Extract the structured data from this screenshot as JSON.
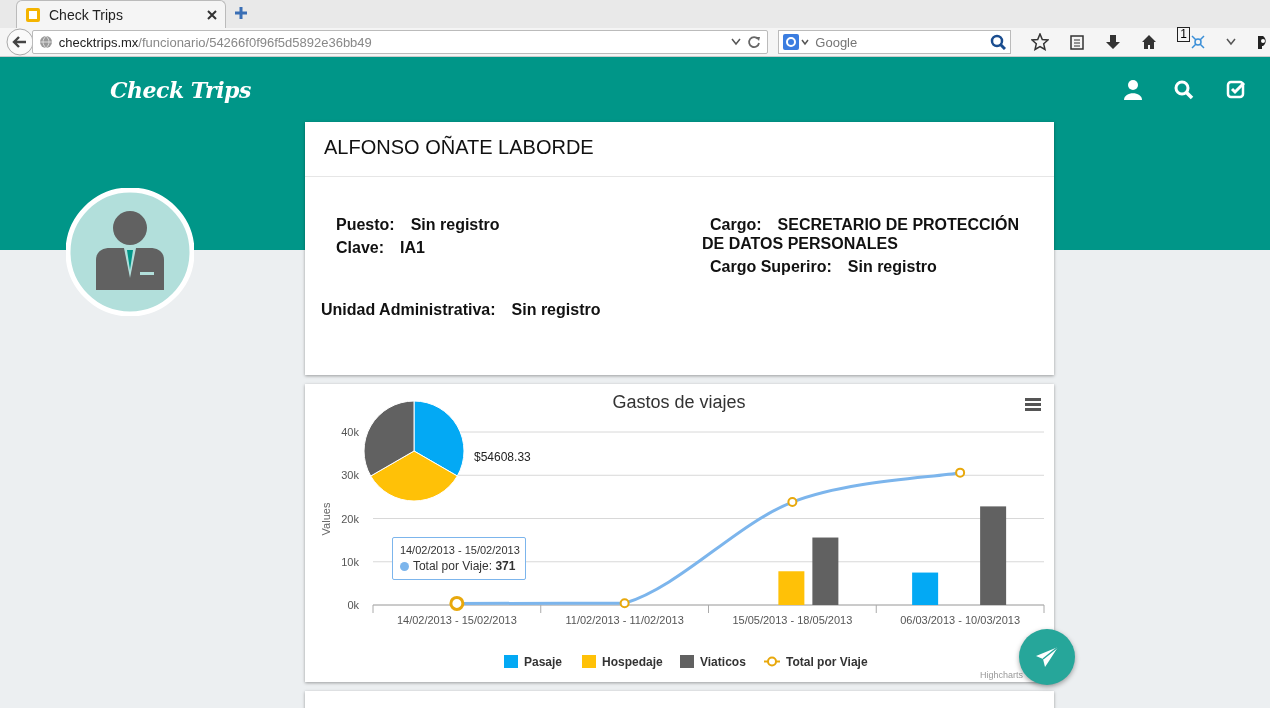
{
  "browser": {
    "tabs": [
      {
        "title": "Check Trips",
        "selected": true
      }
    ],
    "url": {
      "host": "checktrips.mx",
      "path": "/funcionario/54266f0f96f5d5892e36bb49"
    },
    "search": {
      "placeholder": "Google"
    },
    "badge": "1"
  },
  "app": {
    "logo": "Check Trips"
  },
  "profile": {
    "name": "ALFONSO OÑATE LABORDE",
    "fields_left": [
      {
        "label": "Puesto:",
        "value": "Sin registro"
      },
      {
        "label": "Clave:",
        "value": "IA1"
      }
    ],
    "fields_right": [
      {
        "label": "Cargo:",
        "value": "SECRETARIO DE PROTECCIÓN DE DATOS PERSONALES"
      },
      {
        "label": "Cargo Superiro:",
        "value": "Sin registro"
      }
    ],
    "unit": {
      "label": "Unidad Administrativa:",
      "value": "Sin registro"
    }
  },
  "expenses": {
    "chart_data": {
      "type": "bar",
      "title": "Gastos de viajes",
      "ylabel": "Values",
      "categories": [
        "14/02/2013 - 15/02/2013",
        "11/02/2013 - 11/02/2013",
        "15/05/2013 - 18/05/2013",
        "06/03/2013 - 10/03/2013"
      ],
      "ylim": [
        0,
        40000
      ],
      "yticks": [
        {
          "value": 0,
          "label": "0k"
        },
        {
          "value": 10000,
          "label": "10k"
        },
        {
          "value": 20000,
          "label": "20k"
        },
        {
          "value": 30000,
          "label": "30k"
        },
        {
          "value": 40000,
          "label": "40k"
        }
      ],
      "series": [
        {
          "name": "Pasaje",
          "color": "#03a9f4",
          "type": "bar",
          "values": [
            null,
            null,
            null,
            7500
          ]
        },
        {
          "name": "Hospedaje",
          "color": "#ffc107",
          "type": "bar",
          "values": [
            null,
            null,
            7800,
            null
          ]
        },
        {
          "name": "Viaticos",
          "color": "#616161",
          "type": "bar",
          "values": [
            null,
            null,
            15600,
            22800
          ]
        },
        {
          "name": "Total por Viaje",
          "color": "#7cb5ec",
          "type": "line",
          "marker": "circle",
          "values": [
            371,
            400,
            23800,
            30600
          ]
        }
      ],
      "stacked": false,
      "grid": true,
      "legend": "bottom"
    },
    "pie_label": "$54608.33",
    "tooltip": {
      "title": "14/02/2013 - 15/02/2013",
      "text": "Total por Viaje: **371**"
    },
    "credit": "Highcharts"
  }
}
